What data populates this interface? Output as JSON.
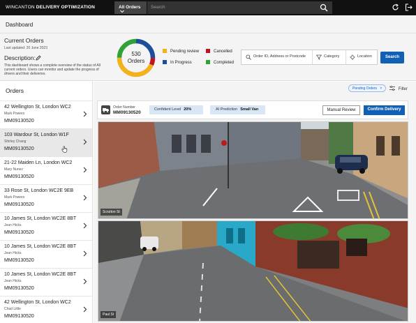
{
  "app": {
    "brand_prefix": "WINCANTON",
    "brand_name": "DELIVERY OPTIMIZATION"
  },
  "topbar": {
    "scope_select": "All Orders",
    "search_placeholder": "Search"
  },
  "page": {
    "breadcrumb": "Dashboard"
  },
  "summary": {
    "title": "Current Orders",
    "last_updated": "Last updated: 20 June 2023",
    "description_label": "Description:",
    "description": "This dashboard shows a complete overview of the status of All current orders. Users can monitor and update the progress of drivers and their deliveries.",
    "total_count": "530",
    "total_label": "Orders",
    "status_legend": [
      {
        "label": "Pending review",
        "color": "#f2b21e"
      },
      {
        "label": "In Progress",
        "color": "#1c4e9c"
      },
      {
        "label": "Cancelled",
        "color": "#c1121f"
      },
      {
        "label": "Completed",
        "color": "#2fa236"
      }
    ]
  },
  "filters": {
    "search_placeholder": "Order ID, Address or Postcode",
    "category_label": "Category",
    "location_label": "Location",
    "search_button": "Search",
    "active_pill": "Pending Orders",
    "pill_close": "×",
    "filter_link": "Filter"
  },
  "orders": {
    "title": "Orders",
    "items": [
      {
        "address": "42 Wellington St, London WC2",
        "name": "Mark Powers",
        "number": "MM09130520"
      },
      {
        "address": "103 Wardour St, London W1F",
        "name": "Shirley Chang",
        "number": "MM09130520"
      },
      {
        "address": "21-22 Maiden Ln, London WC2",
        "name": "Mary Nunez",
        "number": "MM09130520"
      },
      {
        "address": "33 Rose St, London WC2E 9EB",
        "name": "Mark Powers",
        "number": "MM09130520"
      },
      {
        "address": "10 James St, London WC2E 8BT",
        "name": "Jean Hicks",
        "number": "MM09130520"
      },
      {
        "address": "10 James St, London WC2E 8BT",
        "name": "Jean Hicks",
        "number": "MM09130520"
      },
      {
        "address": "10 James St, London WC2E 8BT",
        "name": "Jean Hicks",
        "number": "MM09130520"
      },
      {
        "address": "42 Wellington St, London WC2",
        "name": "Chad Little",
        "number": "MM09130520"
      }
    ]
  },
  "detail": {
    "order_number_label": "Order Number",
    "order_number": "MM09130520",
    "confident_label": "Confident Level",
    "confident_value": "20%",
    "ai_label": "AI Prediction",
    "ai_value": "Small Van",
    "manual_review_button": "Manual Review",
    "confirm_button": "Confirm Delivery",
    "photos": [
      {
        "caption": "Scrutton St"
      },
      {
        "caption": "Paul St"
      }
    ]
  }
}
